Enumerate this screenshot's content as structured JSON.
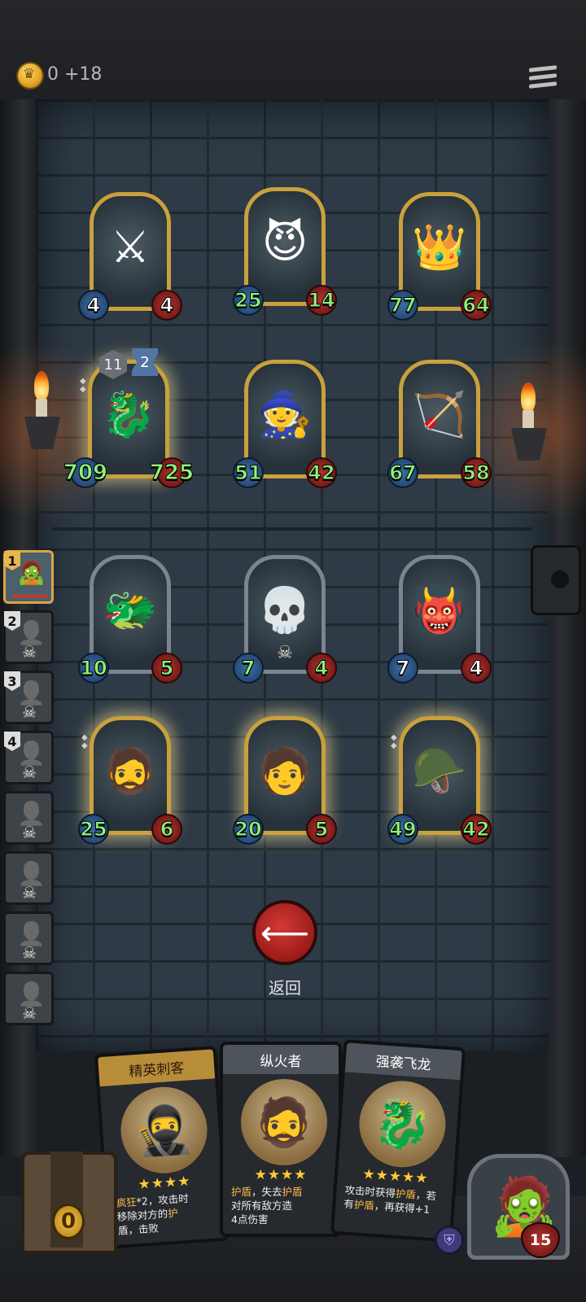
{
  "gold": {
    "amount": "0",
    "income": "+18"
  },
  "board": {
    "enemy_top": [
      {
        "name": "golden-paladin",
        "icon": "⚔",
        "attack": "4",
        "health": "4",
        "frame": "gold"
      },
      {
        "name": "spotted-goblin-witch",
        "icon": "😈",
        "attack": "25",
        "health": "14",
        "frame": "gold"
      },
      {
        "name": "dwarf-king",
        "icon": "👑",
        "attack": "77",
        "health": "64",
        "frame": "gold"
      }
    ],
    "enemy_mid": [
      {
        "name": "spectral-kirin",
        "icon": "🐉",
        "attack": "709",
        "health": "725",
        "frame": "gold",
        "level": "11",
        "rank": "2"
      },
      {
        "name": "blue-haired-sorceress",
        "icon": "🧙",
        "attack": "51",
        "health": "42",
        "frame": "gold"
      },
      {
        "name": "elf-archer",
        "icon": "🏹",
        "attack": "67",
        "health": "58",
        "frame": "gold"
      }
    ],
    "ally_top": [
      {
        "name": "fire-dragon",
        "icon": "🐲",
        "attack": "10",
        "health": "5",
        "frame": "silver"
      },
      {
        "name": "bone-dragon",
        "icon": "💀",
        "attack": "7",
        "health": "4",
        "frame": "silver"
      },
      {
        "name": "horned-demoness",
        "icon": "👹",
        "attack": "7",
        "health": "4",
        "frame": "silver"
      }
    ],
    "ally_bottom": [
      {
        "name": "arsonist-brute",
        "icon": "🧔",
        "attack": "25",
        "health": "6",
        "frame": "gold"
      },
      {
        "name": "blond-warrior",
        "icon": "🧑",
        "attack": "20",
        "health": "5",
        "frame": "gold"
      },
      {
        "name": "helmeted-soldier",
        "icon": "🪖",
        "attack": "49",
        "health": "42",
        "frame": "gold"
      }
    ]
  },
  "queue": [
    "1",
    "2",
    "3",
    "4"
  ],
  "back_button": {
    "label": "返回"
  },
  "hand": [
    {
      "title": "精英刺客",
      "stars": "★★★★",
      "desc_a": "疯狂",
      "desc_b": "*2，攻击时",
      "desc_c": "移除对方的",
      "desc_d": "护",
      "desc_e": "盾，击败"
    },
    {
      "title": "纵火者",
      "stars": "★★★★",
      "desc_a": "护盾",
      "desc_b": "，失去",
      "desc_c": "护盾",
      "desc_d": "对所有敌方造",
      "desc_e": "4点伤害"
    },
    {
      "title": "强袭飞龙",
      "stars": "★★★★★",
      "desc_a": "攻击时获得",
      "desc_b": "护盾",
      "desc_c": "，若",
      "desc_d": "有",
      "desc_e": "护盾",
      "desc_f": "，再获得+1"
    }
  ],
  "chest": {
    "count": "0"
  },
  "player": {
    "health": "15"
  },
  "colors": {
    "gold_frame": "#c9a13c",
    "attack_blue": "#3c6da3",
    "health_red": "#b4302d",
    "accent_orange": "#ffb84a"
  }
}
